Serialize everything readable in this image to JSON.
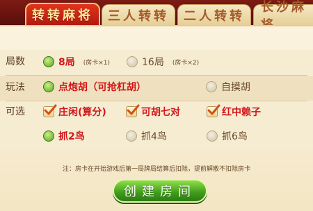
{
  "tabs": [
    {
      "label": "转转麻将",
      "active": true
    },
    {
      "label": "三人转转",
      "active": false
    },
    {
      "label": "二人转转",
      "active": false
    },
    {
      "label": "长沙麻将",
      "active": false
    }
  ],
  "rows": {
    "rounds": {
      "label": "局数",
      "options": [
        {
          "label": "8局",
          "sub": "(房卡×1)",
          "selected": true
        },
        {
          "label": "16局",
          "sub": "(房卡×2)",
          "selected": false
        }
      ]
    },
    "play": {
      "label": "玩法",
      "options": [
        {
          "label": "点炮胡（可抢杠胡）",
          "selected": true
        },
        {
          "label": "自摸胡",
          "selected": false
        }
      ]
    },
    "optional": {
      "label": "可选",
      "options": [
        {
          "label": "庄闲(算分)",
          "checked": true
        },
        {
          "label": "可胡七对",
          "checked": true
        },
        {
          "label": "红中赖子",
          "checked": true
        }
      ]
    },
    "birds": {
      "options": [
        {
          "label": "抓2鸟",
          "selected": true
        },
        {
          "label": "抓4鸟",
          "selected": false
        },
        {
          "label": "抓6鸟",
          "selected": false
        }
      ]
    }
  },
  "note": "注：房卡在开始游戏后第一局牌局结算后扣除，提前解散不扣除房卡",
  "create_button": "创建房间"
}
